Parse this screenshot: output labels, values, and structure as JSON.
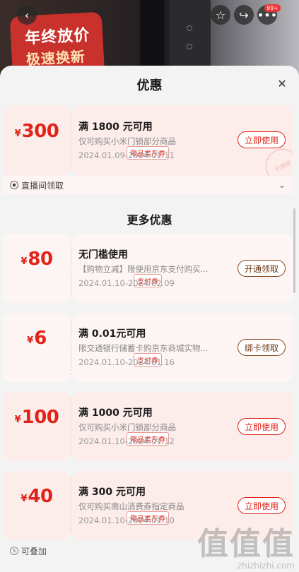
{
  "background": {
    "promo_line_1": "年终放价",
    "promo_line_2": "极速换新",
    "cart_badge": "99+"
  },
  "sheet": {
    "title": "优惠"
  },
  "live_coupon": {
    "currency": "¥",
    "amount": "300",
    "tag": "限品类东券",
    "title": "满 1800 元可用",
    "desc": "仅可购买小米门锁部分商品",
    "date": "2024.01.09-2024.01.11",
    "button": "立即使用",
    "stamp": "已领取",
    "footer": "直播间领取"
  },
  "more_section_title": "更多优惠",
  "coupons": [
    {
      "currency": "¥",
      "amount": "80",
      "tag": "支付券",
      "title": "无门槛使用",
      "desc": "【购物立减】限使用京东支付购买...",
      "date": "2024.01.10-2024.02.09",
      "button": "开通领取"
    },
    {
      "currency": "¥",
      "amount": "6",
      "tag": "支付券",
      "title": "满 0.01元可用",
      "desc": "限交通银行储蓄卡购京东商城实物...",
      "date": "2024.01.10-2024.01.16",
      "button": "绑卡领取"
    },
    {
      "currency": "¥",
      "amount": "100",
      "tag": "限品类东券",
      "title": "满 1000 元可用",
      "desc": "仅可购买小米门锁部分商品",
      "date": "2024.01.10-2024.01.12",
      "button": "立即使用"
    },
    {
      "currency": "¥",
      "amount": "40",
      "tag": "限品类东券",
      "title": "满 300 元可用",
      "desc": "仅可购买南山消费券指定商品",
      "date": "2024.01.10-2024.01.10",
      "button": "立即使用"
    }
  ],
  "stackable_label": "可叠加",
  "watermark": {
    "big": "值值值",
    "small": "zhizhizhi.com"
  },
  "colors": {
    "accent_red": "#e2231a",
    "brown_button": "#6b3612"
  }
}
